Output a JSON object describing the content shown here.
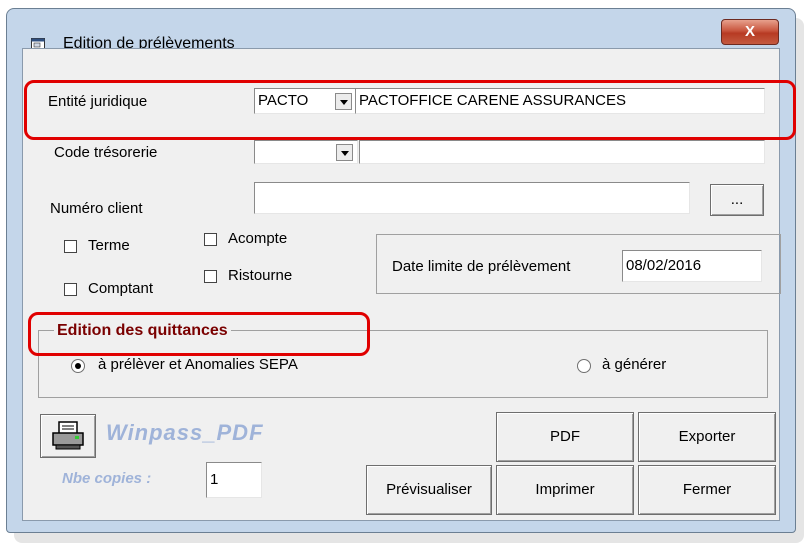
{
  "window": {
    "title": "Edition de prélèvements",
    "close_label": "X"
  },
  "form": {
    "entite_label": "Entité juridique",
    "entite_code": "PACTO",
    "entite_name": "PACTOFFICE CARENE ASSURANCES",
    "tresorerie_label": "Code trésorerie",
    "tresorerie_code": "",
    "tresorerie_name": "",
    "client_label": "Numéro client",
    "client_value": "",
    "browse_label": "..."
  },
  "checkboxes": {
    "terme": "Terme",
    "comptant": "Comptant",
    "acompte": "Acompte",
    "ristourne": "Ristourne"
  },
  "date_limit": {
    "label": "Date  limite de prélèvement",
    "value": "08/02/2016"
  },
  "edition": {
    "title": "Edition des quittances",
    "option1": "à prélèver et Anomalies SEPA",
    "option2": "à générer",
    "selected": "option1"
  },
  "print": {
    "logo_text": "Winpass_PDF",
    "copies_label": "Nbe copies :",
    "copies_value": "1"
  },
  "buttons": {
    "pdf": "PDF",
    "exporter": "Exporter",
    "previsualiser": "Prévisualiser",
    "imprimer": "Imprimer",
    "fermer": "Fermer"
  },
  "colors": {
    "highlight": "#e00000",
    "group_title": "#7a0000",
    "logo": "#9fb3d9"
  }
}
